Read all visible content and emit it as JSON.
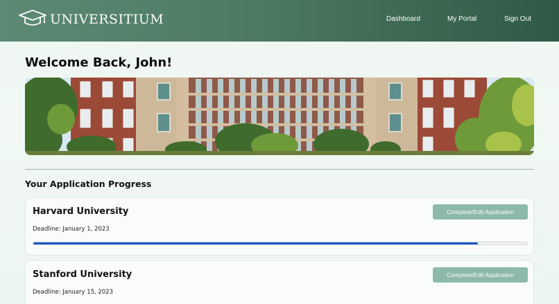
{
  "brand": {
    "name": "UNIVERSITIUM",
    "icon": "graduation-cap-icon"
  },
  "nav": {
    "items": [
      "Dashboard",
      "My Portal",
      "Sign Out"
    ]
  },
  "welcome": "Welcome Back, John!",
  "section_title": "Your Application Progress",
  "applications": [
    {
      "name": "Harvard University",
      "deadline": "Deadline: January 1, 2023",
      "button": "Complete/Edit Application",
      "progress": 0.9
    },
    {
      "name": "Stanford University",
      "deadline": "Deadline: January 15, 2023",
      "button": "Complete/Edit Application"
    }
  ],
  "colors": {
    "header": "#4d7a63",
    "button": "#8cb9a8",
    "progress": "#1e56c9"
  }
}
